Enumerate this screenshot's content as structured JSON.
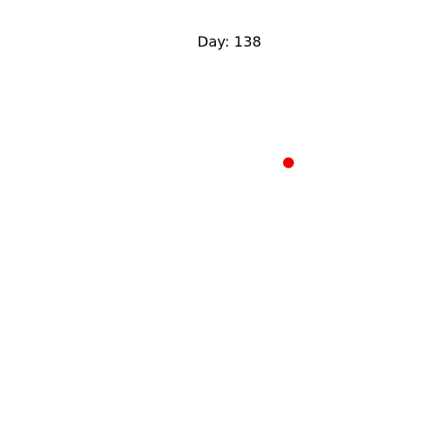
{
  "chart_data": {
    "type": "scatter",
    "title": "Day: 138",
    "xlabel": "",
    "ylabel": "",
    "axes_visible": false,
    "grid": false,
    "legend": "none",
    "xlim": [
      0,
      1
    ],
    "ylim": [
      0,
      1
    ],
    "series": [
      {
        "color": "#ee0000",
        "points": [
          {
            "x": 0.67,
            "y": 0.68
          }
        ]
      }
    ]
  }
}
